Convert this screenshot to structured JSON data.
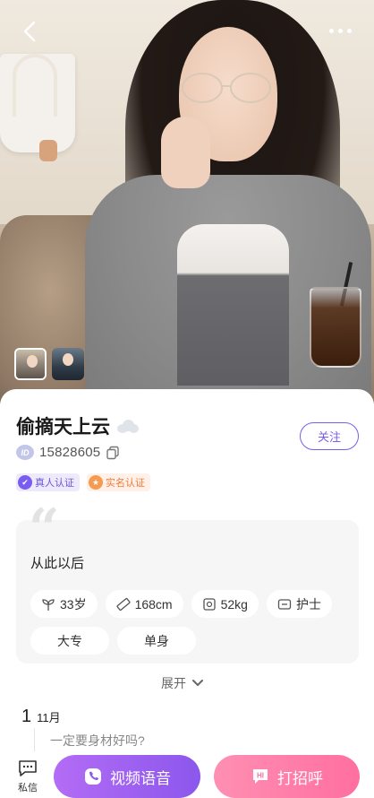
{
  "profile": {
    "name": "偷摘天上云",
    "id_label": "ID",
    "id_value": "15828605",
    "follow_label": "关注"
  },
  "badges": [
    {
      "label": "真人认证",
      "icon": "verified-person-icon"
    },
    {
      "label": "实名认证",
      "icon": "verified-identity-icon"
    }
  ],
  "intro": {
    "bio": "从此以后",
    "tags": [
      {
        "label": "33岁",
        "icon": "sprout-icon"
      },
      {
        "label": "168cm",
        "icon": "ruler-icon"
      },
      {
        "label": "52kg",
        "icon": "scale-icon"
      },
      {
        "label": "护士",
        "icon": "occupation-icon"
      },
      {
        "label": "大专",
        "icon": ""
      },
      {
        "label": "单身",
        "icon": ""
      }
    ],
    "expand_label": "展开"
  },
  "timeline": {
    "day": "1",
    "month": "11月",
    "post_text": "一定要身材好吗?"
  },
  "bottom_bar": {
    "message_label": "私信",
    "video_label": "视频语音",
    "greet_label": "打招呼"
  },
  "colors": {
    "accent_purple": "#7a5cf0",
    "video_button": "#a064f1",
    "greet_button": "#ff7aa8",
    "badge_orange": "#f07a3a"
  }
}
